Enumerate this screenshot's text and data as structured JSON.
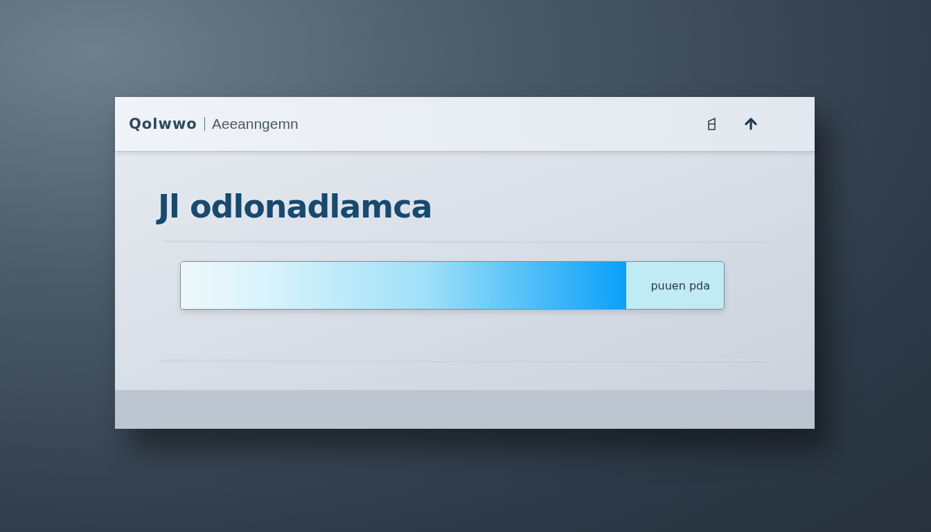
{
  "header": {
    "brand": "Qolwwo",
    "subtitle": "Aeeanngemn"
  },
  "heading": "Jl odlonadlamca",
  "progress": {
    "level": 0.82,
    "label": "puuen pda"
  }
}
